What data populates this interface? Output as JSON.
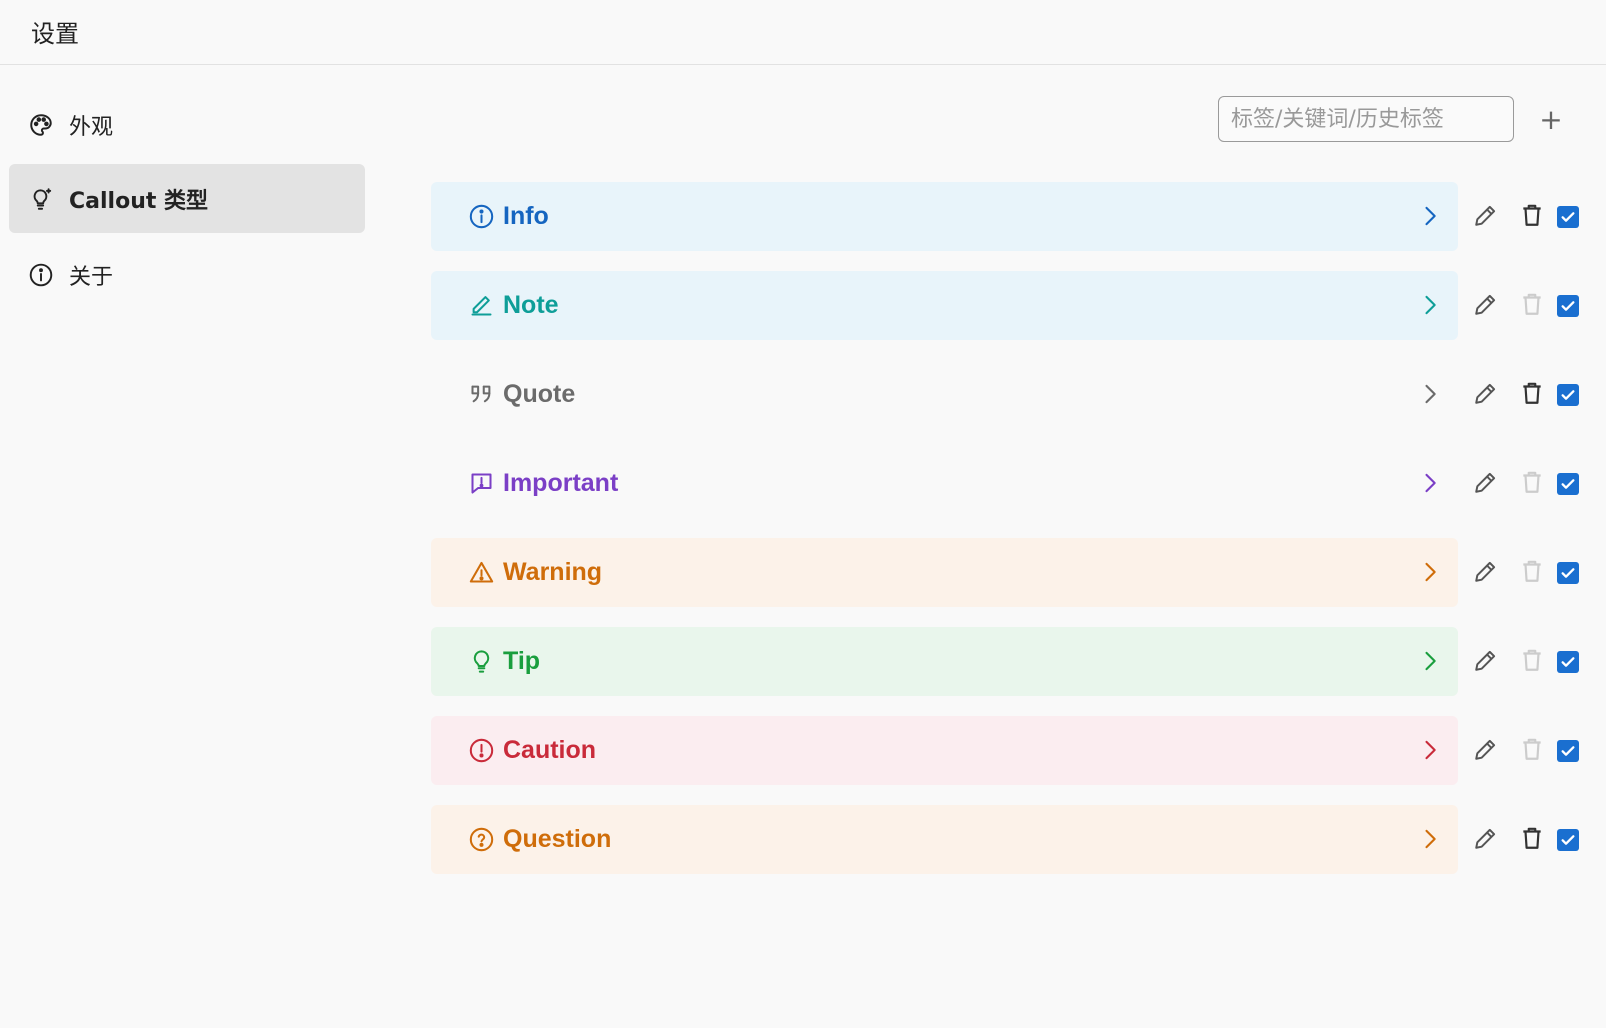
{
  "window": {
    "title": "设置"
  },
  "sidebar": {
    "items": [
      {
        "label": "外观",
        "icon": "palette-icon",
        "active": false
      },
      {
        "label": "Callout 类型",
        "icon": "lightbulb-sparkle-icon",
        "active": true
      },
      {
        "label": "关于",
        "icon": "info-circle-icon",
        "active": false
      }
    ]
  },
  "search": {
    "placeholder": "标签/关键词/历史标签",
    "value": ""
  },
  "toolbar": {
    "add_label": "+"
  },
  "callouts": [
    {
      "label": "Info",
      "icon": "info-circle-icon",
      "color": "#1565c0",
      "bg": "#e8f4fa",
      "deletable": true,
      "enabled": true
    },
    {
      "label": "Note",
      "icon": "pencil-icon",
      "color": "#0e9e98",
      "bg": "#e8f4fa",
      "deletable": false,
      "enabled": true
    },
    {
      "label": "Quote",
      "icon": "quote-icon",
      "color": "#6b6b6b",
      "bg": "#f9f9f9",
      "deletable": true,
      "enabled": true
    },
    {
      "label": "Important",
      "icon": "message-alert-icon",
      "color": "#7b3fc6",
      "bg": "#f9f9f9",
      "deletable": false,
      "enabled": true
    },
    {
      "label": "Warning",
      "icon": "warning-triangle-icon",
      "color": "#cf6d0a",
      "bg": "#fcf2e9",
      "deletable": false,
      "enabled": true
    },
    {
      "label": "Tip",
      "icon": "lightbulb-icon",
      "color": "#1a9e3e",
      "bg": "#e9f6ec",
      "deletable": false,
      "enabled": true
    },
    {
      "label": "Caution",
      "icon": "alert-circle-icon",
      "color": "#c92b3a",
      "bg": "#fbedf0",
      "deletable": false,
      "enabled": true
    },
    {
      "label": "Question",
      "icon": "question-circle-icon",
      "color": "#cf6d0a",
      "bg": "#fcf2e9",
      "deletable": true,
      "enabled": true
    }
  ],
  "colors": {
    "checkbox": "#1a6fd0",
    "action_icon": "#555555",
    "disabled_icon": "#cccccc"
  }
}
